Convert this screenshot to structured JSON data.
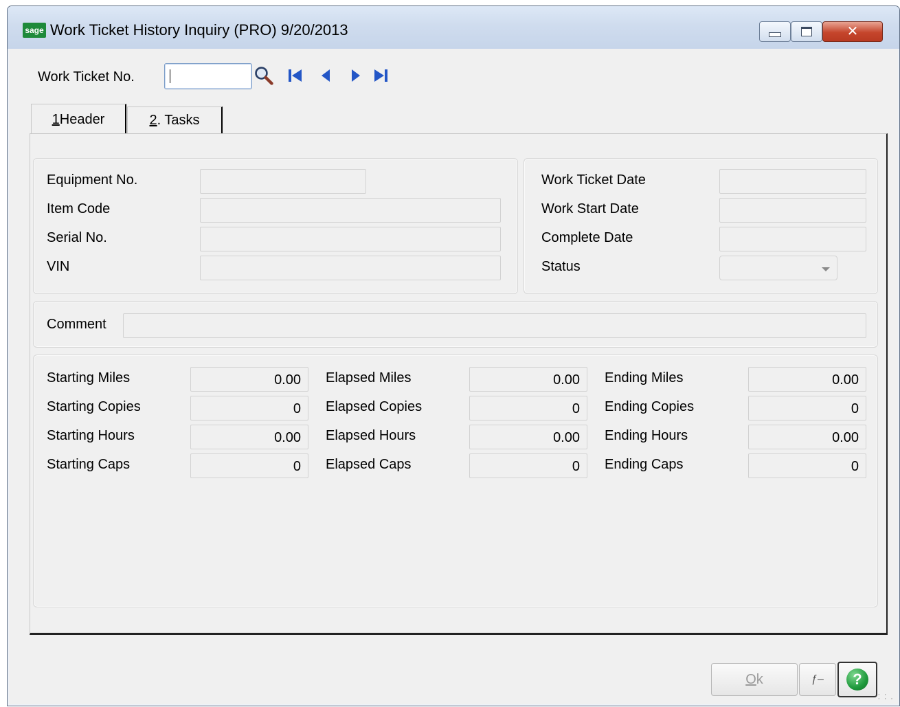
{
  "window": {
    "logo_text": "sage",
    "title": "Work Ticket History Inquiry (PRO) 9/20/2013",
    "min_icon": "minimize-icon",
    "max_icon": "maximize-icon",
    "close_icon": "close-icon",
    "close_glyph": "✕"
  },
  "toolbar": {
    "work_ticket_label": "Work Ticket No.",
    "work_ticket_value": "",
    "nav_icons": [
      "lookup-magnifier-icon",
      "first-record-icon",
      "previous-record-icon",
      "next-record-icon",
      "last-record-icon"
    ]
  },
  "tabs": [
    {
      "key": "1",
      "rest": " Header",
      "selected": true
    },
    {
      "key": "2",
      "rest": ". Tasks",
      "selected": false
    }
  ],
  "equipment": {
    "equipment_no_label": "Equipment No.",
    "item_code_label": "Item Code",
    "serial_no_label": "Serial No.",
    "vin_label": "VIN"
  },
  "dates": {
    "work_ticket_date_label": "Work Ticket Date",
    "work_start_date_label": "Work Start Date",
    "complete_date_label": "Complete Date",
    "status_label": "Status",
    "status_value": ""
  },
  "comment": {
    "label": "Comment",
    "value": ""
  },
  "meters": {
    "starting": [
      {
        "label": "Starting Miles",
        "value": "0.00"
      },
      {
        "label": "Starting Copies",
        "value": "0"
      },
      {
        "label": "Starting Hours",
        "value": "0.00"
      },
      {
        "label": "Starting Caps",
        "value": "0"
      }
    ],
    "elapsed": [
      {
        "label": "Elapsed Miles",
        "value": "0.00"
      },
      {
        "label": "Elapsed Copies",
        "value": "0"
      },
      {
        "label": "Elapsed Hours",
        "value": "0.00"
      },
      {
        "label": "Elapsed Caps",
        "value": "0"
      }
    ],
    "ending": [
      {
        "label": "Ending Miles",
        "value": "0.00"
      },
      {
        "label": "Ending Copies",
        "value": "0"
      },
      {
        "label": "Ending Hours",
        "value": "0.00"
      },
      {
        "label": "Ending Caps",
        "value": "0"
      }
    ]
  },
  "buttons": {
    "ok_key": "O",
    "ok_rest": "k",
    "function_glyph": "ƒ–",
    "help_glyph": "?"
  },
  "colors": {
    "help_button": "#1f9a3c",
    "close_button": "#c5452c",
    "nav_icon": "#2356c6"
  }
}
